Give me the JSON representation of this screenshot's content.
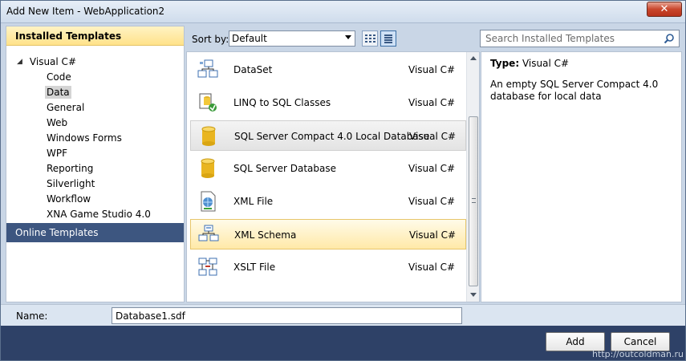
{
  "window": {
    "title": "Add New Item - WebApplication2",
    "close_glyph": "✕"
  },
  "left": {
    "installed_header": "Installed Templates",
    "root": "Visual C#",
    "items": [
      "Code",
      "Data",
      "General",
      "Web",
      "Windows Forms",
      "WPF",
      "Reporting",
      "Silverlight",
      "Workflow",
      "XNA Game Studio 4.0"
    ],
    "selected": "Data",
    "online_header": "Online Templates"
  },
  "sortbar": {
    "label": "Sort by:",
    "value": "Default"
  },
  "templates": [
    {
      "name": "DataSet",
      "lang": "Visual C#",
      "icon": "dataset-icon"
    },
    {
      "name": "LINQ to SQL Classes",
      "lang": "Visual C#",
      "icon": "linq-icon"
    },
    {
      "name": "SQL Server Compact 4.0 Local Database",
      "lang": "Visual C#",
      "icon": "database-icon"
    },
    {
      "name": "SQL Server Database",
      "lang": "Visual C#",
      "icon": "database-icon"
    },
    {
      "name": "XML File",
      "lang": "Visual C#",
      "icon": "xml-file-icon"
    },
    {
      "name": "XML Schema",
      "lang": "Visual C#",
      "icon": "xml-schema-icon"
    },
    {
      "name": "XSLT File",
      "lang": "Visual C#",
      "icon": "xslt-icon"
    }
  ],
  "search": {
    "placeholder": "Search Installed Templates"
  },
  "details": {
    "type_label": "Type:",
    "type_value": "Visual C#",
    "description": "An empty SQL Server Compact 4.0 database for local data"
  },
  "name_field": {
    "label": "Name:",
    "value": "Database1.sdf"
  },
  "buttons": {
    "add": "Add",
    "cancel": "Cancel"
  },
  "watermark": "http://outcoldman.ru"
}
